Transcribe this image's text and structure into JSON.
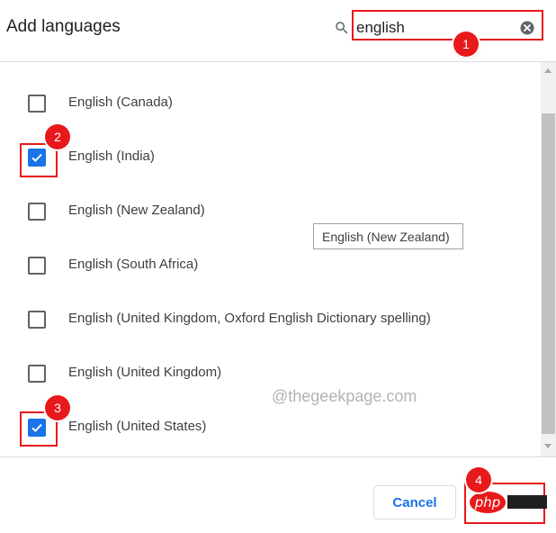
{
  "header": {
    "title": "Add languages",
    "search_value": "english",
    "search_icon": "search-icon",
    "clear_icon": "clear-icon"
  },
  "languages": [
    {
      "label": "English (Canada)",
      "checked": false
    },
    {
      "label": "English (India)",
      "checked": true
    },
    {
      "label": "English (New Zealand)",
      "checked": false
    },
    {
      "label": "English (South Africa)",
      "checked": false
    },
    {
      "label": "English (United Kingdom, Oxford English Dictionary spelling)",
      "checked": false
    },
    {
      "label": "English (United Kingdom)",
      "checked": false
    },
    {
      "label": "English (United States)",
      "checked": true
    }
  ],
  "tooltip": "English (New Zealand)",
  "watermark": "@thegeekpage.com",
  "footer": {
    "cancel_label": "Cancel",
    "logo_text": "php"
  },
  "annotations": {
    "step1": "1",
    "step2": "2",
    "step3": "3",
    "step4": "4"
  },
  "colors": {
    "accent": "#1a73e8",
    "annotation": "#e8191b"
  }
}
